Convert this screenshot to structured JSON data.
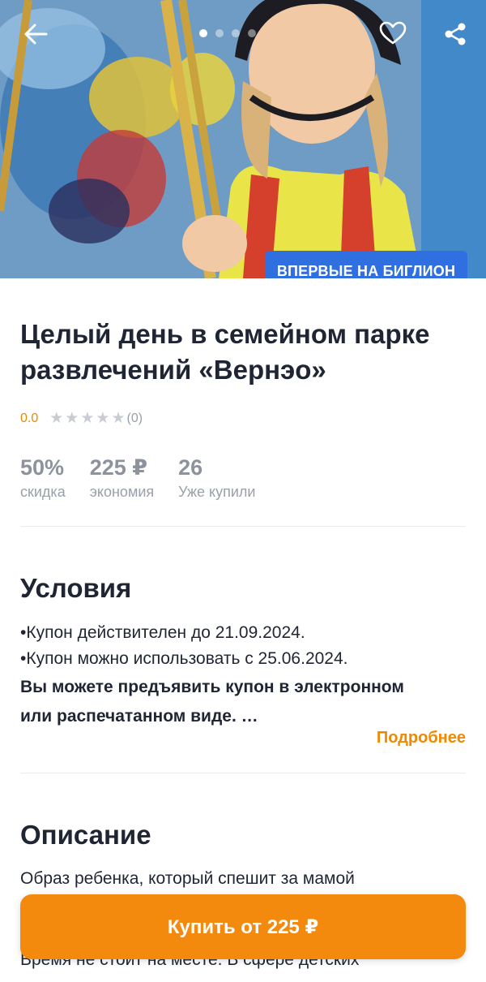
{
  "hero": {
    "image_description": "",
    "slides_total": 4,
    "active_slide": 1,
    "badge": "ВПЕРВЫЕ НА БИГЛИОН",
    "icons": {
      "back": "arrow-left-icon",
      "favorite": "heart-outline-icon",
      "share": "share-icon"
    }
  },
  "deal": {
    "title": "Целый день в семейном парке развлечений «Вернэо»",
    "rating_value": "0.0",
    "rating_stars": 0,
    "rating_count": "(0)"
  },
  "stats": [
    {
      "value": "50%",
      "label": "скидка"
    },
    {
      "value": "225 ₽",
      "label": "экономия"
    },
    {
      "value": "26",
      "label": "Уже купили"
    }
  ],
  "conditions": {
    "title": "Условия",
    "lines": [
      "•Купон действителен до 21.09.2024.",
      "•Купон можно использовать с 25.06.2024."
    ],
    "bold_line_1": "Вы можете предъявить купон в электронном",
    "bold_line_2": "или распечатанном виде. …",
    "more_label": "Подробнее"
  },
  "description": {
    "title": "Описание",
    "text": "Образ ребенка, который спешит за мамой",
    "text_tail": "Время не стоит на месте. В сфере детских"
  },
  "buy_button": {
    "label": "Купить от 225 ₽"
  },
  "colors": {
    "accent_orange": "#f48a0d",
    "badge_blue": "#2f6fe0",
    "rating_orange": "#e88a00"
  }
}
